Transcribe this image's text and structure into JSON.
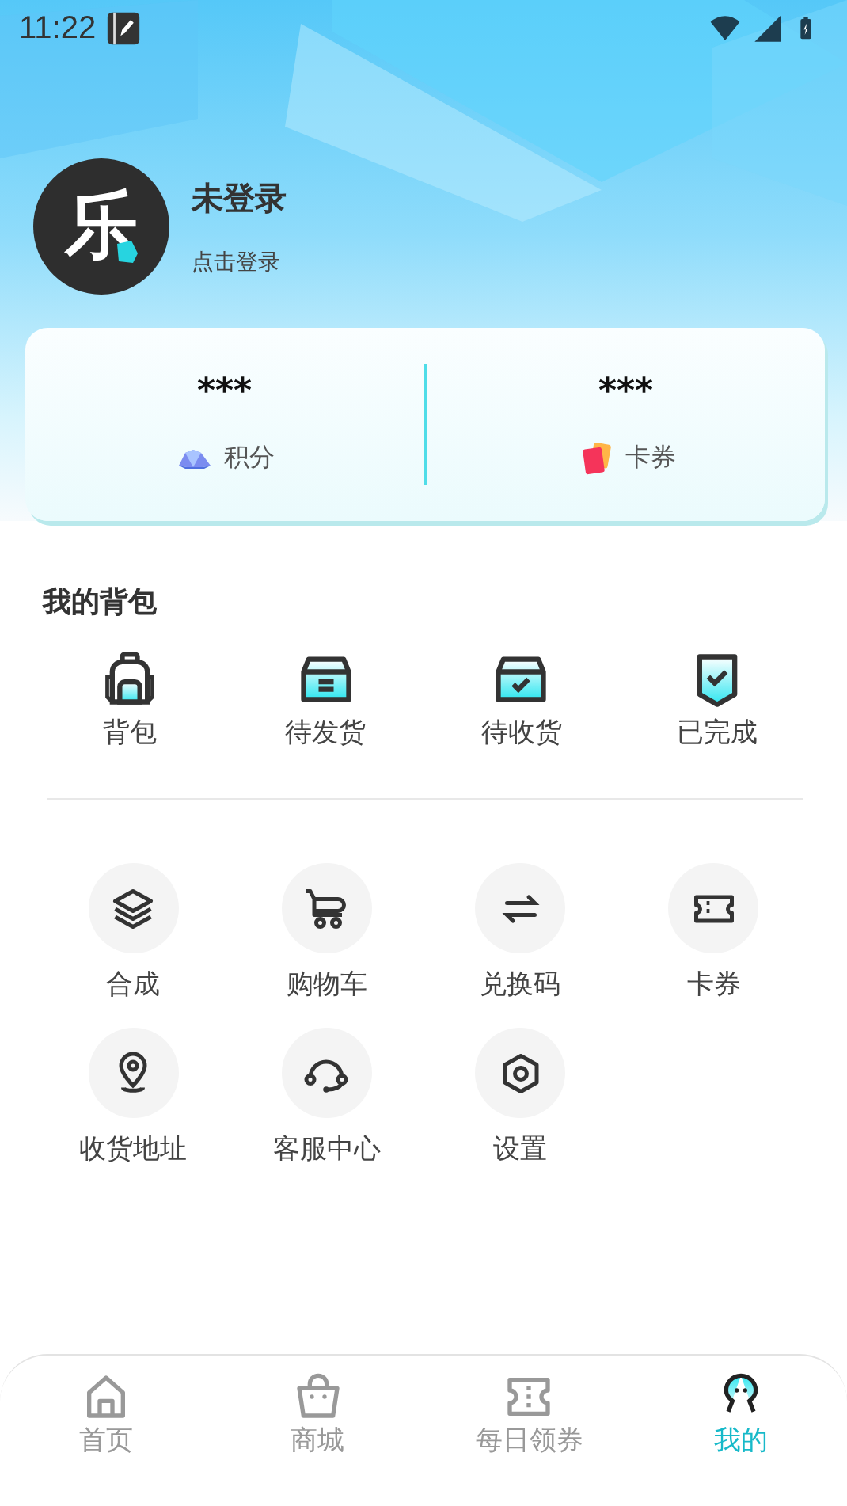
{
  "status_bar": {
    "time": "11:22"
  },
  "profile": {
    "avatar_text": "乐",
    "name": "未登录",
    "hint": "点击登录"
  },
  "stats": [
    {
      "kind": "points",
      "value": "***",
      "label": "积分"
    },
    {
      "kind": "coupons",
      "value": "***",
      "label": "卡券"
    }
  ],
  "backpack": {
    "title": "我的背包",
    "items": [
      {
        "kind": "backpack",
        "label": "背包"
      },
      {
        "kind": "to-ship",
        "label": "待发货"
      },
      {
        "kind": "to-receive",
        "label": "待收货"
      },
      {
        "kind": "done",
        "label": "已完成"
      }
    ]
  },
  "services": [
    {
      "kind": "compose",
      "label": "合成"
    },
    {
      "kind": "cart",
      "label": "购物车"
    },
    {
      "kind": "redeem",
      "label": "兑换码"
    },
    {
      "kind": "ticket",
      "label": "卡券"
    },
    {
      "kind": "address",
      "label": "收货地址"
    },
    {
      "kind": "support",
      "label": "客服中心"
    },
    {
      "kind": "settings",
      "label": "设置"
    }
  ],
  "tab_bar": [
    {
      "kind": "home",
      "label": "首页",
      "selected": false
    },
    {
      "kind": "shop",
      "label": "商城",
      "selected": false
    },
    {
      "kind": "daily",
      "label": "每日领券",
      "selected": false
    },
    {
      "kind": "mine",
      "label": "我的",
      "selected": true
    }
  ]
}
